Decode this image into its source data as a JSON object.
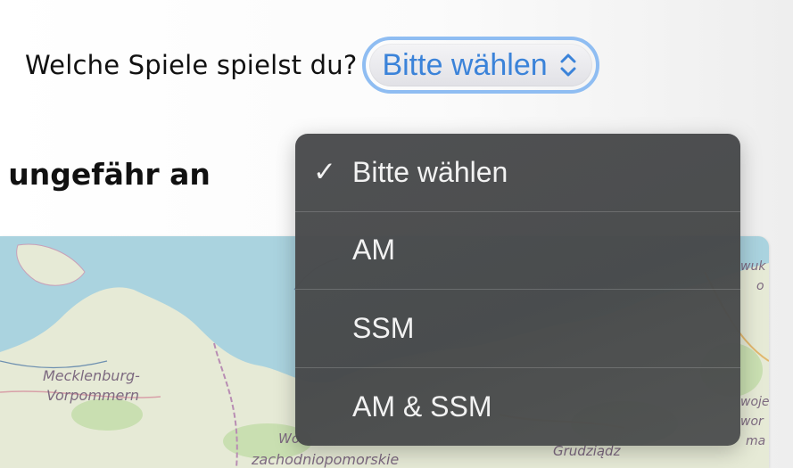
{
  "question": {
    "label": "Welche Spiele spielst du?"
  },
  "select": {
    "value": "Bitte wählen",
    "accent_color": "#3b83d9",
    "focus_ring_color": "#8fbdf2"
  },
  "section": {
    "heading_partial": "t ungefähr an"
  },
  "map": {
    "labels": [
      "Mecklenburg-",
      "Vorpommern",
      "Wo",
      "zachodniopomorskie",
      "Grudziądz",
      "wuk",
      "o",
      "woje",
      "wor",
      "ma"
    ]
  },
  "dropdown": {
    "options": [
      {
        "label": "Bitte wählen",
        "selected": true
      },
      {
        "label": "AM",
        "selected": false
      },
      {
        "label": "SSM",
        "selected": false
      },
      {
        "label": "AM & SSM",
        "selected": false
      }
    ],
    "check_icon": "checkmark-icon"
  }
}
